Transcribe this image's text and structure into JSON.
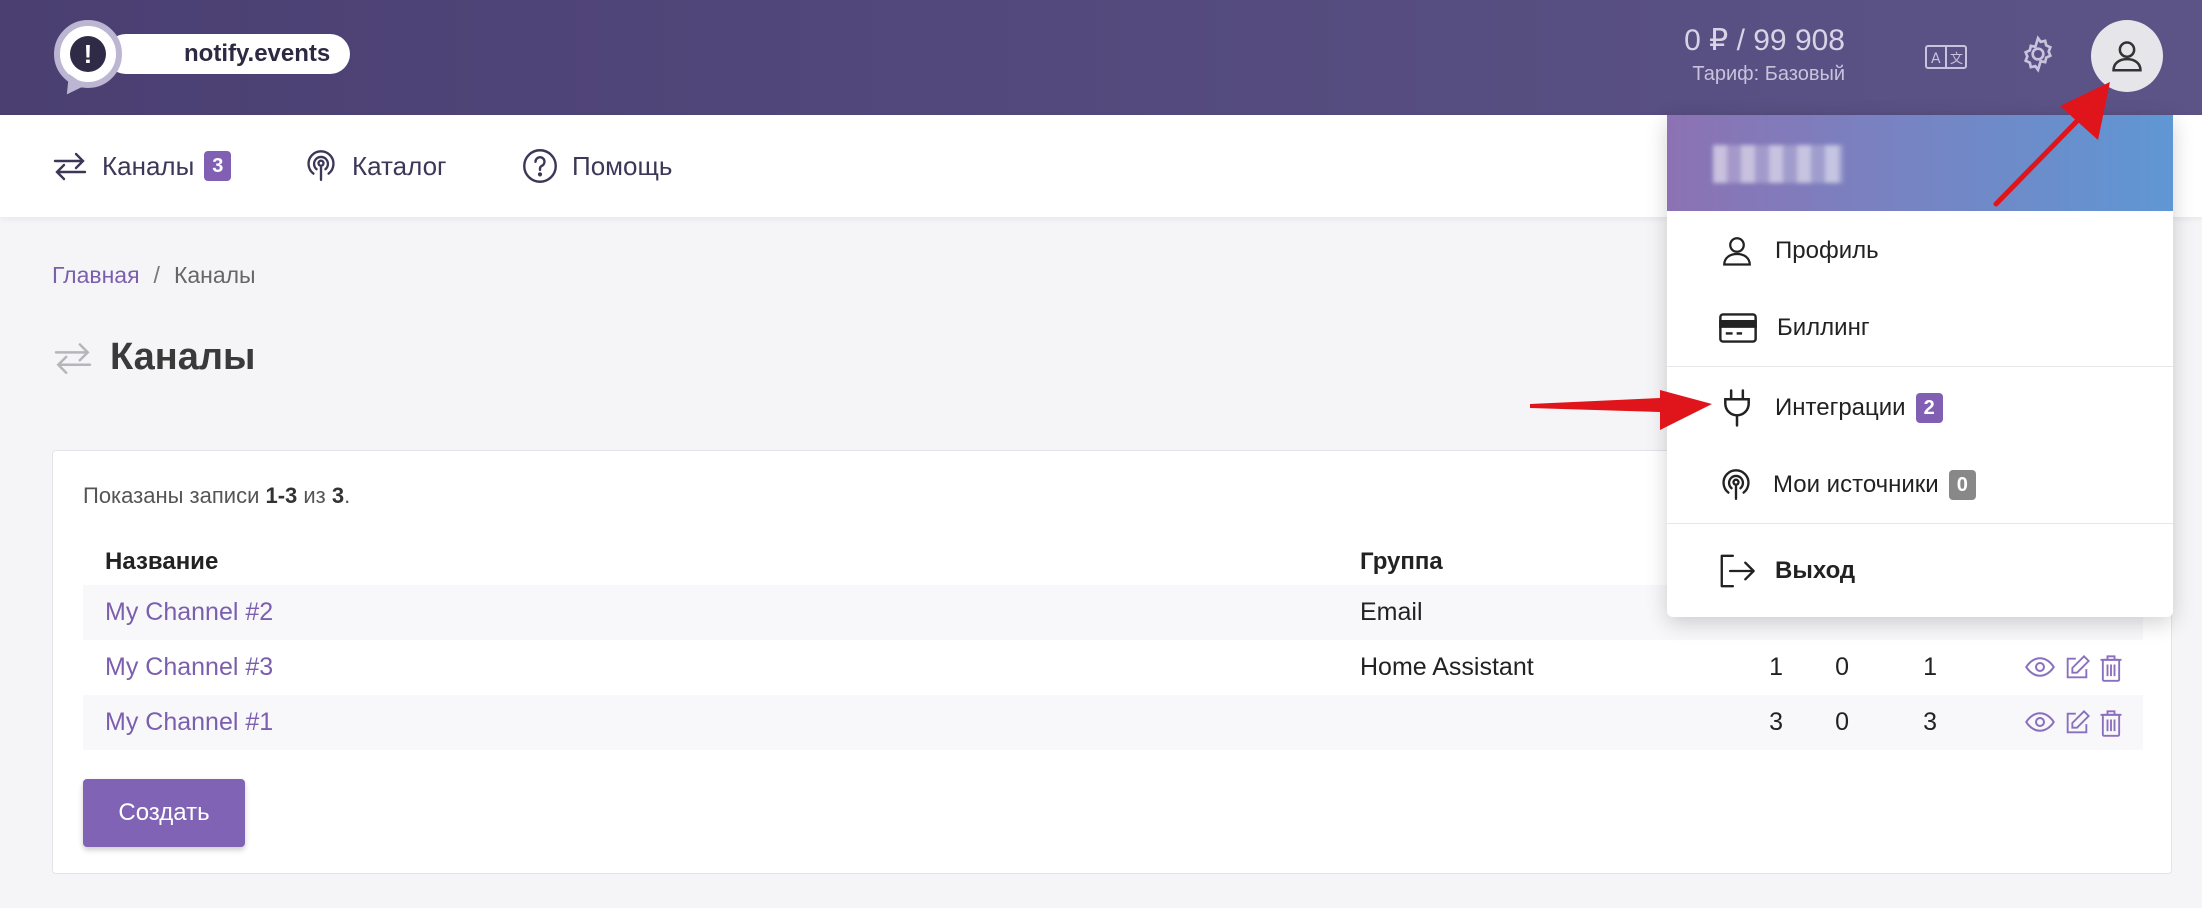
{
  "header": {
    "logo_mark": "!",
    "logo_text": "notify.events",
    "balance": "0 ₽ / 99 908",
    "tariff": "Тариф: Базовый"
  },
  "nav": {
    "items": [
      {
        "label": "Каналы",
        "badge": "3"
      },
      {
        "label": "Каталог"
      },
      {
        "label": "Помощь"
      }
    ]
  },
  "breadcrumb": {
    "home": "Главная",
    "separator": "/",
    "current": "Каналы"
  },
  "page": {
    "title": "Каналы"
  },
  "table": {
    "summary_prefix": "Показаны записи ",
    "summary_range": "1-3",
    "summary_mid": " из ",
    "summary_total": "3",
    "summary_suffix": ".",
    "headers": {
      "name": "Название",
      "group": "Группа"
    },
    "rows": [
      {
        "name": "My Channel #2",
        "group": "Email",
        "v1": "",
        "v2": "",
        "v3": ""
      },
      {
        "name": "My Channel #3",
        "group": "Home Assistant",
        "v1": "1",
        "v2": "0",
        "v3": "1"
      },
      {
        "name": "My Channel #1",
        "group": "",
        "v1": "3",
        "v2": "0",
        "v3": "3"
      }
    ],
    "create_label": "Создать"
  },
  "dropdown": {
    "items": [
      {
        "label": "Профиль",
        "icon": "user-icon"
      },
      {
        "label": "Биллинг",
        "icon": "credit-card-icon"
      },
      {
        "label": "Интеграции",
        "icon": "plug-icon",
        "badge": "2"
      },
      {
        "label": "Мои источники",
        "icon": "podcast-icon",
        "badge": "0"
      },
      {
        "label": "Выход",
        "icon": "logout-icon"
      }
    ]
  },
  "colors": {
    "header_bg": "#4b3f72",
    "accent": "#8160b4",
    "link": "#7b5fae",
    "annotation_arrow": "#e0151b"
  }
}
